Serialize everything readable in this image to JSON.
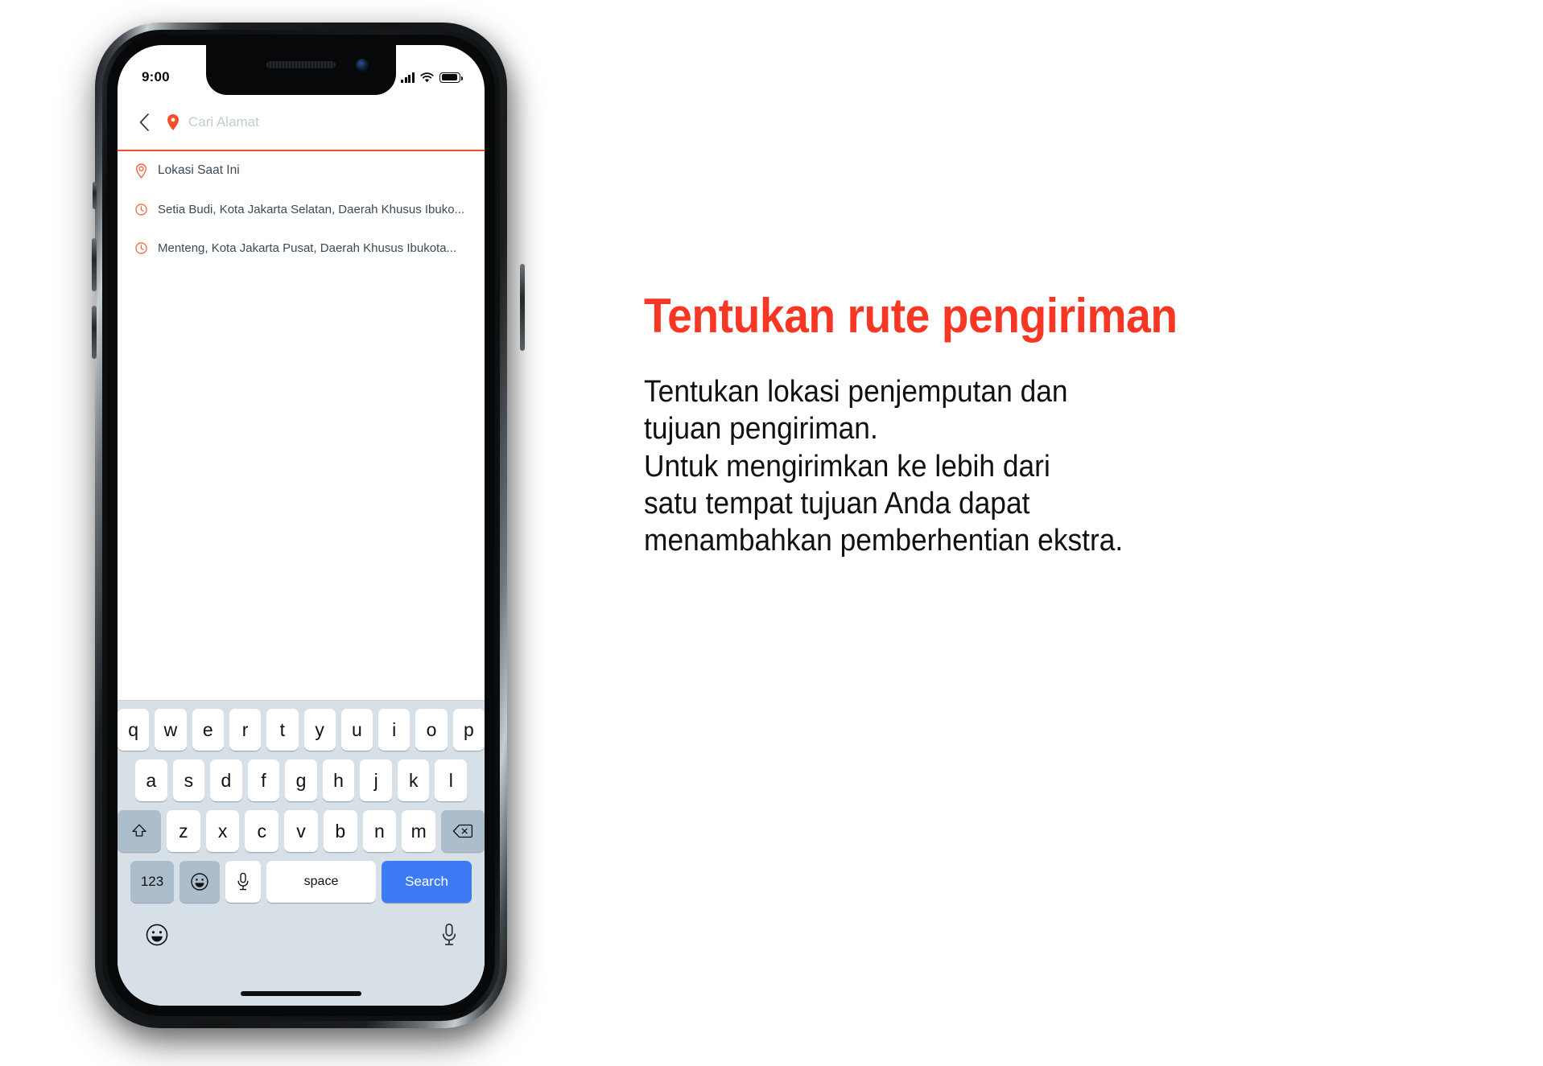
{
  "phone": {
    "status_bar": {
      "time": "9:00",
      "signal_icon": "cellular-signal-icon",
      "wifi_icon": "wifi-icon",
      "battery_icon": "battery-full-icon"
    },
    "app": {
      "header": {
        "back_icon": "back-chevron-icon",
        "pin_icon": "map-pin-icon",
        "search_placeholder": "Cari Alamat",
        "search_value": "",
        "underline_color": "#f5502a"
      },
      "suggestions": [
        {
          "icon": "location-pin-outline-icon",
          "label": "Lokasi Saat Ini"
        },
        {
          "icon": "history-clock-icon",
          "label": "Setia Budi, Kota Jakarta Selatan, Daerah Khusus Ibuko..."
        },
        {
          "icon": "history-clock-icon",
          "label": "Menteng, Kota Jakarta Pusat, Daerah Khusus Ibukota..."
        }
      ],
      "keyboard": {
        "row1": [
          "q",
          "w",
          "e",
          "r",
          "t",
          "y",
          "u",
          "i",
          "o",
          "p"
        ],
        "row2": [
          "a",
          "s",
          "d",
          "f",
          "g",
          "h",
          "j",
          "k",
          "l"
        ],
        "row3": [
          "z",
          "x",
          "c",
          "v",
          "b",
          "n",
          "m"
        ],
        "shift_icon": "shift-arrow-icon",
        "backspace_icon": "backspace-delete-icon",
        "numbers_label": "123",
        "emoji_icon": "emoji-smiley-icon",
        "mic_icon": "microphone-icon",
        "space_label": "space",
        "search_label": "Search",
        "search_key_color": "#3d7bf5",
        "bottom_emoji_icon": "emoji-smiley-icon",
        "bottom_mic_icon": "microphone-icon"
      }
    }
  },
  "panel": {
    "title": "Tentukan rute pengiriman",
    "title_color": "#f73723",
    "body_lines": [
      "Tentukan lokasi penjemputan dan",
      "tujuan pengiriman.",
      "Untuk mengirimkan ke lebih dari",
      "satu tempat tujuan Anda dapat",
      "menambahkan pemberhentian ekstra."
    ]
  }
}
